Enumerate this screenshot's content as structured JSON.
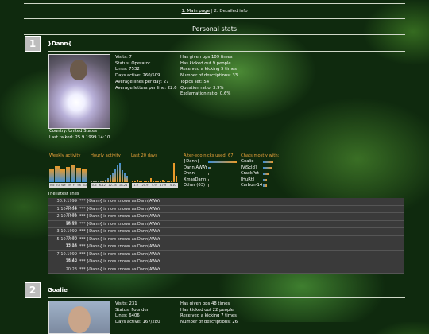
{
  "nav": {
    "main_link": "1. Main page",
    "separator": " | ",
    "detail": "2. Detailed info"
  },
  "section_title": "Personal stats",
  "users": [
    {
      "rank": "1",
      "nick": "}Dann{",
      "stats_left": [
        "Visits: 7",
        "Status: Operator",
        "Lines: 7532",
        "Days active: 260/509",
        "Average lines per day: 27",
        "Average letters per line: 22.6"
      ],
      "stats_right": [
        "Has given ops 109 times",
        "Has kicked out 9 people",
        "Received a kicking 5 times",
        "Number of descriptions: 33",
        "Topics set: 54",
        "Question ratio: 3.9%",
        "Exclamation ratio: 0.6%"
      ],
      "country": "Country: United States",
      "last_talked": "Last talked: 25.9.1999 14:10",
      "labels": {
        "weekly": "Weekly activity",
        "hourly": "Hourly activity",
        "last20": "Last 20 days",
        "alter": "Alter-ego nicks used: 67",
        "chats": "Chats mostly with:"
      },
      "weekly_axis": [
        "Mo",
        "Tu",
        "We",
        "Th",
        "Fr",
        "Sa",
        "Su"
      ],
      "weekly_values": [
        0.62,
        0.75,
        0.58,
        0.7,
        0.82,
        0.66,
        0.6
      ],
      "hourly_axis": [
        "0-6",
        "6-12",
        "12-18",
        "18-24"
      ],
      "hourly_values": [
        0.05,
        0.04,
        0.03,
        0.02,
        0.05,
        0.08,
        0.1,
        0.2,
        0.35,
        0.45,
        0.6,
        0.8,
        0.9,
        0.55,
        0.4,
        0.3
      ],
      "last20_axis": [
        "1.9",
        "20.9",
        "4.9",
        "17.9",
        "4.10"
      ],
      "last20_values": [
        0,
        0,
        0.1,
        0,
        0.05,
        0,
        0,
        0,
        0.2,
        0,
        0,
        0,
        0,
        0.1,
        0,
        0,
        0,
        0,
        0.9,
        0.3
      ],
      "alter_nicks": [
        {
          "name": "}Dann{",
          "value": 1.0
        },
        {
          "name": "Dann|AWAY",
          "value": 0.1
        },
        {
          "name": "Dnnn",
          "value": 0.02
        },
        {
          "name": "XmasDann",
          "value": 0.02
        },
        {
          "name": "Other (63)",
          "value": 0.03
        }
      ],
      "chats_with": [
        {
          "name": "Goalie",
          "value": 0.7
        },
        {
          "name": "[ViScId]",
          "value": 0.65
        },
        {
          "name": "CrackPot",
          "value": 0.4
        },
        {
          "name": "[HuRt]",
          "value": 0.3
        },
        {
          "name": "Carbon-14",
          "value": 0.3
        }
      ],
      "latest_label": "The latest lines",
      "latest_lines": [
        {
          "time": "30.9.1999 20:45",
          "text": "*** }Dann{ is now known as Dann|AWAY"
        },
        {
          "time": "1.10.1999 20:21",
          "text": "*** }Dann{ is now known as Dann|AWAY"
        },
        {
          "time": "2.10.1999 16:09",
          "text": "*** }Dann{ is now known as Dann|AWAY"
        },
        {
          "time": "16:16",
          "text": "*** }Dann{ is now known as Dann|AWAY"
        },
        {
          "time": "3.10.1999 21:20",
          "text": "*** }Dann{ is now known as Dann|AWAY"
        },
        {
          "time": "5.10.1999 13:16",
          "text": "*** }Dann{ is now known as Dann|AWAY"
        },
        {
          "time": "22:03",
          "text": "*** }Dann{ is now known as Dann|AWAY"
        },
        {
          "time": "7.10.1999 13:40",
          "text": "*** }Dann{ is now known as Dann|AWAY"
        },
        {
          "time": "15:49",
          "text": "*** }Dann{ is now known as Dann|AWAY"
        },
        {
          "time": "20:23",
          "text": "*** }Dann{ is now known as Dann|AWAY"
        }
      ]
    },
    {
      "rank": "2",
      "nick": "Goalie",
      "stats_left": [
        "Visits: 231",
        "Status: Founder",
        "Lines: 6406",
        "Days active: 167/280"
      ],
      "stats_right": [
        "Has given ops 48 times",
        "Has kicked out 22 people",
        "Received a kicking 7 times",
        "Number of descriptions: 26"
      ]
    }
  ],
  "colors": {
    "weekly_bar": "#e99a2a",
    "weekly_bar2": "#3b8fd9",
    "hourly_bar": "#3b8fd9",
    "hourly_bar2": "#e99a2a",
    "nick_bar": "#3b8fd9",
    "chat_bar": "#e99a2a",
    "label": "#e9a23a"
  }
}
